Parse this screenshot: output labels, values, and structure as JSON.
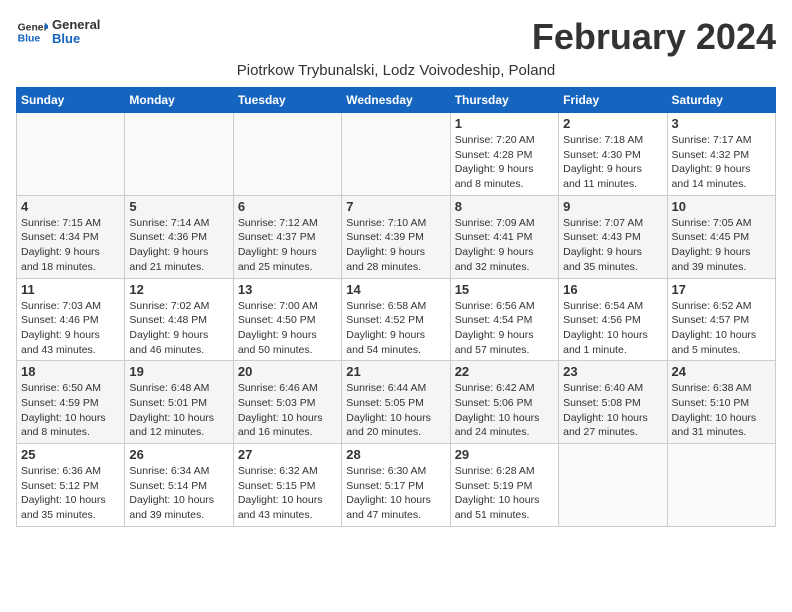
{
  "header": {
    "logo_general": "General",
    "logo_blue": "Blue",
    "month_title": "February 2024",
    "subtitle": "Piotrkow Trybunalski, Lodz Voivodeship, Poland"
  },
  "days_of_week": [
    "Sunday",
    "Monday",
    "Tuesday",
    "Wednesday",
    "Thursday",
    "Friday",
    "Saturday"
  ],
  "weeks": [
    [
      {
        "day": "",
        "info": ""
      },
      {
        "day": "",
        "info": ""
      },
      {
        "day": "",
        "info": ""
      },
      {
        "day": "",
        "info": ""
      },
      {
        "day": "1",
        "info": "Sunrise: 7:20 AM\nSunset: 4:28 PM\nDaylight: 9 hours\nand 8 minutes."
      },
      {
        "day": "2",
        "info": "Sunrise: 7:18 AM\nSunset: 4:30 PM\nDaylight: 9 hours\nand 11 minutes."
      },
      {
        "day": "3",
        "info": "Sunrise: 7:17 AM\nSunset: 4:32 PM\nDaylight: 9 hours\nand 14 minutes."
      }
    ],
    [
      {
        "day": "4",
        "info": "Sunrise: 7:15 AM\nSunset: 4:34 PM\nDaylight: 9 hours\nand 18 minutes."
      },
      {
        "day": "5",
        "info": "Sunrise: 7:14 AM\nSunset: 4:36 PM\nDaylight: 9 hours\nand 21 minutes."
      },
      {
        "day": "6",
        "info": "Sunrise: 7:12 AM\nSunset: 4:37 PM\nDaylight: 9 hours\nand 25 minutes."
      },
      {
        "day": "7",
        "info": "Sunrise: 7:10 AM\nSunset: 4:39 PM\nDaylight: 9 hours\nand 28 minutes."
      },
      {
        "day": "8",
        "info": "Sunrise: 7:09 AM\nSunset: 4:41 PM\nDaylight: 9 hours\nand 32 minutes."
      },
      {
        "day": "9",
        "info": "Sunrise: 7:07 AM\nSunset: 4:43 PM\nDaylight: 9 hours\nand 35 minutes."
      },
      {
        "day": "10",
        "info": "Sunrise: 7:05 AM\nSunset: 4:45 PM\nDaylight: 9 hours\nand 39 minutes."
      }
    ],
    [
      {
        "day": "11",
        "info": "Sunrise: 7:03 AM\nSunset: 4:46 PM\nDaylight: 9 hours\nand 43 minutes."
      },
      {
        "day": "12",
        "info": "Sunrise: 7:02 AM\nSunset: 4:48 PM\nDaylight: 9 hours\nand 46 minutes."
      },
      {
        "day": "13",
        "info": "Sunrise: 7:00 AM\nSunset: 4:50 PM\nDaylight: 9 hours\nand 50 minutes."
      },
      {
        "day": "14",
        "info": "Sunrise: 6:58 AM\nSunset: 4:52 PM\nDaylight: 9 hours\nand 54 minutes."
      },
      {
        "day": "15",
        "info": "Sunrise: 6:56 AM\nSunset: 4:54 PM\nDaylight: 9 hours\nand 57 minutes."
      },
      {
        "day": "16",
        "info": "Sunrise: 6:54 AM\nSunset: 4:56 PM\nDaylight: 10 hours\nand 1 minute."
      },
      {
        "day": "17",
        "info": "Sunrise: 6:52 AM\nSunset: 4:57 PM\nDaylight: 10 hours\nand 5 minutes."
      }
    ],
    [
      {
        "day": "18",
        "info": "Sunrise: 6:50 AM\nSunset: 4:59 PM\nDaylight: 10 hours\nand 8 minutes."
      },
      {
        "day": "19",
        "info": "Sunrise: 6:48 AM\nSunset: 5:01 PM\nDaylight: 10 hours\nand 12 minutes."
      },
      {
        "day": "20",
        "info": "Sunrise: 6:46 AM\nSunset: 5:03 PM\nDaylight: 10 hours\nand 16 minutes."
      },
      {
        "day": "21",
        "info": "Sunrise: 6:44 AM\nSunset: 5:05 PM\nDaylight: 10 hours\nand 20 minutes."
      },
      {
        "day": "22",
        "info": "Sunrise: 6:42 AM\nSunset: 5:06 PM\nDaylight: 10 hours\nand 24 minutes."
      },
      {
        "day": "23",
        "info": "Sunrise: 6:40 AM\nSunset: 5:08 PM\nDaylight: 10 hours\nand 27 minutes."
      },
      {
        "day": "24",
        "info": "Sunrise: 6:38 AM\nSunset: 5:10 PM\nDaylight: 10 hours\nand 31 minutes."
      }
    ],
    [
      {
        "day": "25",
        "info": "Sunrise: 6:36 AM\nSunset: 5:12 PM\nDaylight: 10 hours\nand 35 minutes."
      },
      {
        "day": "26",
        "info": "Sunrise: 6:34 AM\nSunset: 5:14 PM\nDaylight: 10 hours\nand 39 minutes."
      },
      {
        "day": "27",
        "info": "Sunrise: 6:32 AM\nSunset: 5:15 PM\nDaylight: 10 hours\nand 43 minutes."
      },
      {
        "day": "28",
        "info": "Sunrise: 6:30 AM\nSunset: 5:17 PM\nDaylight: 10 hours\nand 47 minutes."
      },
      {
        "day": "29",
        "info": "Sunrise: 6:28 AM\nSunset: 5:19 PM\nDaylight: 10 hours\nand 51 minutes."
      },
      {
        "day": "",
        "info": ""
      },
      {
        "day": "",
        "info": ""
      }
    ]
  ]
}
